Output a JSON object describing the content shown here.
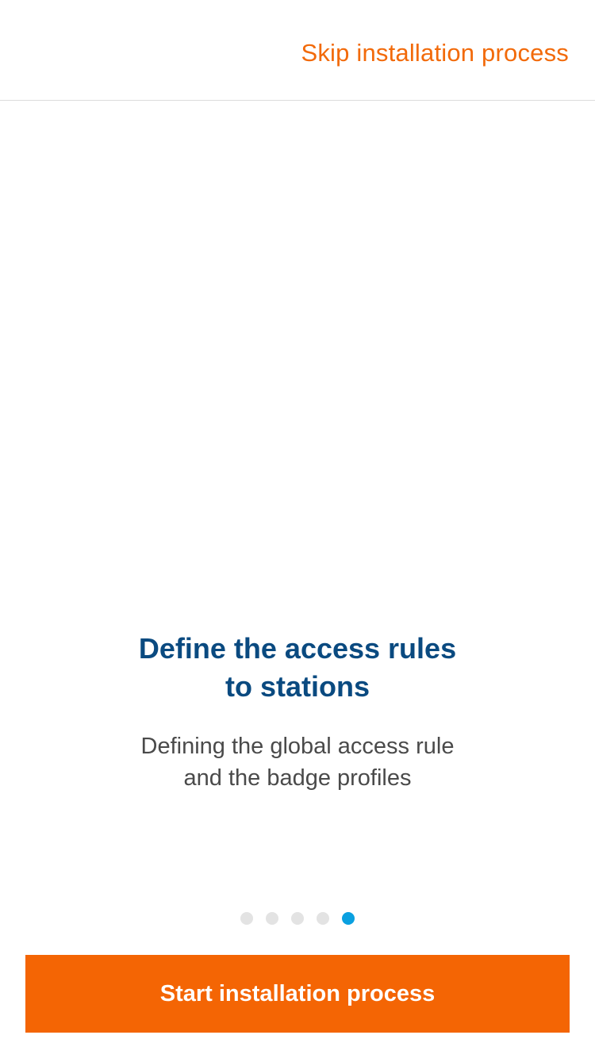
{
  "header": {
    "skip_label": "Skip installation process"
  },
  "slide": {
    "title_line1": "Define the access rules",
    "title_line2": "to stations",
    "subtitle_line1": "Defining the global access rule",
    "subtitle_line2": "and the badge profiles"
  },
  "pager": {
    "total": 5,
    "current": 5
  },
  "footer": {
    "start_label": "Start installation process"
  },
  "colors": {
    "accent": "#f46504",
    "title": "#0a4a80",
    "active_dot": "#0aa0e0",
    "inactive_dot": "#e3e3e3"
  }
}
